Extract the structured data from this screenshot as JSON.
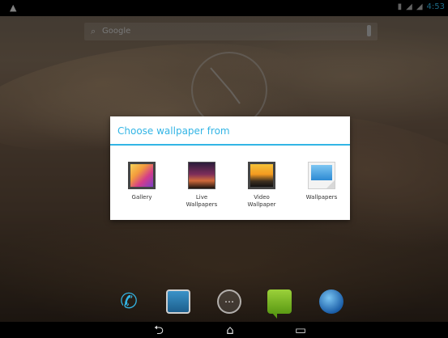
{
  "status_bar": {
    "left_icon": "notification-icon",
    "time": "4:53",
    "accent": "#33b5e5"
  },
  "search": {
    "label": "Google"
  },
  "dialog": {
    "title": "Choose wallpaper from",
    "title_color": "#33b5e5",
    "options": [
      {
        "label": "Gallery",
        "icon": "gallery-icon"
      },
      {
        "label": "Live\nWallpapers",
        "icon": "live-wallpapers-icon"
      },
      {
        "label": "Video\nWallpaper",
        "icon": "video-wallpaper-icon"
      },
      {
        "label": "Wallpapers",
        "icon": "wallpapers-icon"
      }
    ]
  },
  "dock": {
    "items": [
      "phone-icon",
      "contacts-icon",
      "app-drawer-icon",
      "messaging-icon",
      "browser-icon"
    ],
    "apps_glyph": "⋯"
  },
  "nav": {
    "back_glyph": "⮌",
    "home_glyph": "⌂",
    "recent_glyph": "▭"
  }
}
